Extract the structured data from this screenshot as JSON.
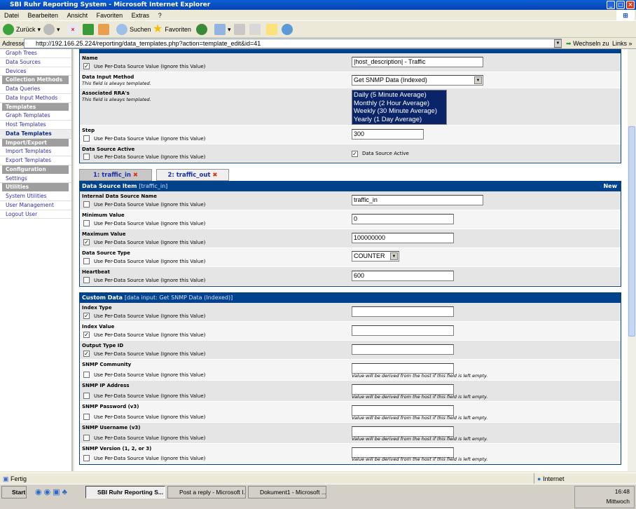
{
  "window": {
    "title": "SBI Ruhr Reporting System - Microsoft Internet Explorer"
  },
  "menu": [
    "Datei",
    "Bearbeiten",
    "Ansicht",
    "Favoriten",
    "Extras",
    "?"
  ],
  "toolbar": {
    "back": "Zurück",
    "search": "Suchen",
    "favorites": "Favoriten"
  },
  "address": {
    "label": "Adresse",
    "url": "http://192.166.25.224/reporting/data_templates.php?action=template_edit&id=41",
    "go": "Wechseln zu",
    "links": "Links"
  },
  "sidebar": [
    {
      "label": "Graph Trees",
      "type": "item"
    },
    {
      "label": "Data Sources",
      "type": "item"
    },
    {
      "label": "Devices",
      "type": "item"
    },
    {
      "label": "Collection Methods",
      "type": "header"
    },
    {
      "label": "Data Queries",
      "type": "item"
    },
    {
      "label": "Data Input Methods",
      "type": "item"
    },
    {
      "label": "Templates",
      "type": "header"
    },
    {
      "label": "Graph Templates",
      "type": "item"
    },
    {
      "label": "Host Templates",
      "type": "item"
    },
    {
      "label": "Data Templates",
      "type": "current"
    },
    {
      "label": "Import/Export",
      "type": "header"
    },
    {
      "label": "Import Templates",
      "type": "item"
    },
    {
      "label": "Export Templates",
      "type": "item"
    },
    {
      "label": "Configuration",
      "type": "header"
    },
    {
      "label": "Settings",
      "type": "item"
    },
    {
      "label": "Utilities",
      "type": "header"
    },
    {
      "label": "System Utilities",
      "type": "item"
    },
    {
      "label": "User Management",
      "type": "item"
    },
    {
      "label": "Logout User",
      "type": "item"
    }
  ],
  "per_ds_label": "Use Per-Data Source Value (Ignore this Value)",
  "top_panel": {
    "rows": [
      {
        "label": "Name",
        "checked": true,
        "control": "text",
        "value": "|host_description| - Traffic",
        "w": "long"
      },
      {
        "label": "Data Input Method",
        "desc": "This field is always templated.",
        "control": "select",
        "value": "Get SNMP Data (Indexed)",
        "w": "xl"
      },
      {
        "label": "Associated RRA's",
        "desc": "This field is always templated.",
        "control": "listbox",
        "options": [
          "Daily (5 Minute Average)",
          "Monthly (2 Hour Average)",
          "Weekly (30 Minute Average)",
          "Yearly (1 Day Average)"
        ]
      },
      {
        "label": "Step",
        "checked": false,
        "control": "text",
        "value": "300",
        "w": "step"
      },
      {
        "label": "Data Source Active",
        "checked": false,
        "control": "checkbox",
        "value": "Data Source Active",
        "ctl_checked": true
      }
    ]
  },
  "tabs": [
    {
      "label": "1: traffic_in",
      "active": true
    },
    {
      "label": "2: traffic_out",
      "active": false
    }
  ],
  "ds_item": {
    "title": "Data Source Item",
    "subtitle": "[traffic_in]",
    "new": "New",
    "rows": [
      {
        "label": "Internal Data Source Name",
        "checked": false,
        "control": "text",
        "value": "traffic_in",
        "w": "long"
      },
      {
        "label": "Minimum Value",
        "checked": false,
        "control": "text",
        "value": "0",
        "w": "short"
      },
      {
        "label": "Maximum Value",
        "checked": true,
        "control": "text",
        "value": "100000000",
        "w": "short"
      },
      {
        "label": "Data Source Type",
        "checked": false,
        "control": "select",
        "value": "COUNTER",
        "w": "type"
      },
      {
        "label": "Heartbeat",
        "checked": false,
        "control": "text",
        "value": "600",
        "w": "short"
      }
    ]
  },
  "custom_data": {
    "title": "Custom Data",
    "subtitle": "[data input: Get SNMP Data (Indexed)]",
    "hint": "Value will be derived from the host if this field is left empty.",
    "rows": [
      {
        "label": "Index Type",
        "checked": true,
        "control": "text",
        "value": "",
        "w": "short"
      },
      {
        "label": "Index Value",
        "checked": true,
        "control": "text",
        "value": "",
        "w": "short"
      },
      {
        "label": "Output Type ID",
        "checked": true,
        "control": "text",
        "value": "",
        "w": "short"
      },
      {
        "label": "SNMP Community",
        "checked": false,
        "control": "text",
        "value": "",
        "w": "short",
        "hint": true
      },
      {
        "label": "SNMP IP Address",
        "checked": false,
        "control": "text",
        "value": "",
        "w": "short",
        "hint": true
      },
      {
        "label": "SNMP Password (v3)",
        "checked": false,
        "control": "text",
        "value": "",
        "w": "short",
        "hint": true
      },
      {
        "label": "SNMP Username (v3)",
        "checked": false,
        "control": "text",
        "value": "",
        "w": "short",
        "hint": true
      },
      {
        "label": "SNMP Version (1, 2, or 3)",
        "checked": false,
        "control": "text",
        "value": "",
        "w": "short",
        "hint": true
      }
    ]
  },
  "status": {
    "text": "Fertig",
    "zone": "Internet"
  },
  "taskbar": {
    "start": "Start",
    "tasks": [
      "SBI Ruhr Reporting S...",
      "Post a reply - Microsoft I...",
      "Dokument1 - Microsoft ..."
    ],
    "time": "16:48",
    "day": "Mittwoch"
  },
  "colors": {
    "panel_header": "#00438C",
    "row_dark": "#E5E5E5",
    "row_light": "#F5F5F5",
    "sidebar_header": "#9E9E9E",
    "link": "#3330AA"
  }
}
